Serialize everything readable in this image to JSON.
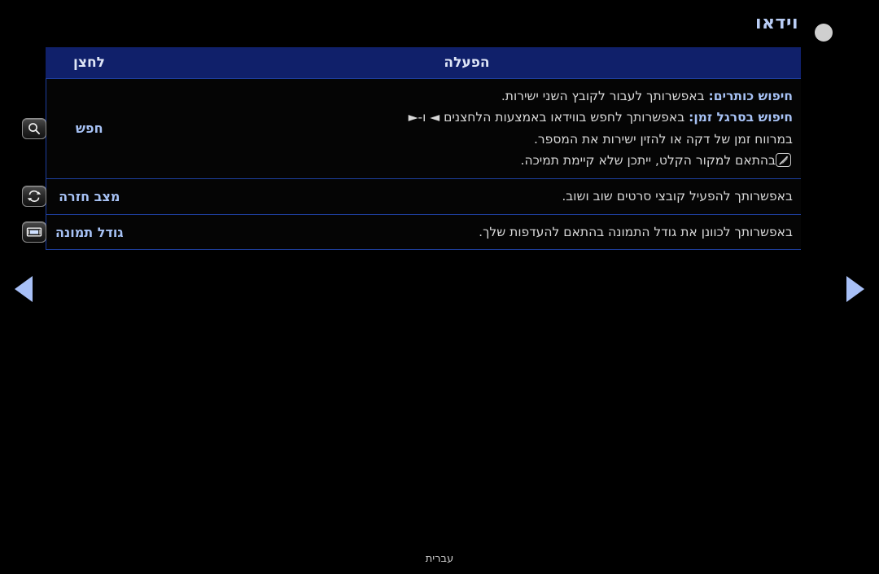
{
  "header": {
    "title": "וידאו",
    "status_dot": "circle-indicator"
  },
  "table": {
    "columns": [
      {
        "key": "operation",
        "label": "הפעלה"
      },
      {
        "key": "button",
        "label": "לחצן"
      }
    ],
    "rows": [
      {
        "button_icon": "search-icon",
        "name": "חפש",
        "desc_lines": [
          {
            "label": "חיפוש כותרים:",
            "text": " באפשרותך לעבור לקובץ השני ישירות."
          },
          {
            "label": "חיפוש בסרגל זמן:",
            "text": " באפשרותך לחפש בווידאו באמצעות הלחצנים ◄ ו-►"
          },
          {
            "label": "",
            "text": "במרווח זמן של דקה או להזין ישירות את המספר."
          },
          {
            "label": "",
            "text": "בהתאם למקור הקלט, ייתכן שלא קיימת תמיכה.",
            "note": true
          }
        ]
      },
      {
        "button_icon": "repeat-icon",
        "name": "מצב חזרה",
        "desc_lines": [
          {
            "label": "",
            "text": "באפשרותך להפעיל קובצי סרטים שוב ושוב."
          }
        ]
      },
      {
        "button_icon": "picture-size-icon",
        "name": "גודל תמונה",
        "desc_lines": [
          {
            "label": "",
            "text": "באפשרותך לכוונן את גודל התמונה בהתאם להעדפות שלך."
          }
        ]
      }
    ]
  },
  "navigation": {
    "prev_label": "prev-page-arrow",
    "next_label": "next-page-arrow"
  },
  "footer": {
    "language": "עברית"
  },
  "colors": {
    "header_bg": "#10206a",
    "accent_text": "#a7c2f5",
    "border": "#1e3f9e",
    "body_text": "#d8d8d8",
    "arrow": "#a8c0f7",
    "dot": "#cfcfcf"
  }
}
